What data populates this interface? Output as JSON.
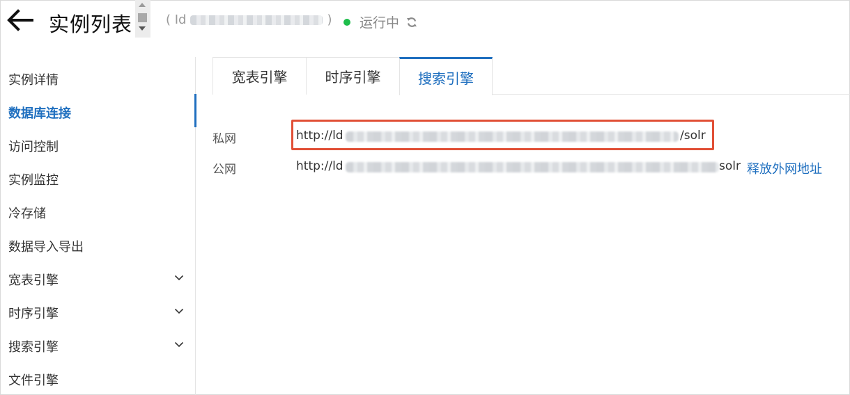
{
  "header": {
    "title": "实例列表",
    "id_open": "( Id",
    "id_close": ")",
    "status_text": "运行中",
    "status_color": "#1ebe4b"
  },
  "sidebar": {
    "items": [
      {
        "label": "实例详情"
      },
      {
        "label": "数据库连接",
        "active": true
      },
      {
        "label": "访问控制"
      },
      {
        "label": "实例监控"
      },
      {
        "label": "冷存储"
      },
      {
        "label": "数据导入导出"
      },
      {
        "label": "宽表引擎",
        "expandable": true
      },
      {
        "label": "时序引擎",
        "expandable": true
      },
      {
        "label": "搜索引擎",
        "expandable": true
      },
      {
        "label": "文件引擎"
      }
    ]
  },
  "tabs": [
    {
      "label": "宽表引擎"
    },
    {
      "label": "时序引擎"
    },
    {
      "label": "搜索引擎",
      "active": true
    }
  ],
  "connections": {
    "private": {
      "label": "私网",
      "prefix": "http://ld",
      "suffix": "/solr"
    },
    "public": {
      "label": "公网",
      "prefix": "http://ld",
      "suffix": "solr",
      "action": "释放外网地址"
    }
  },
  "colors": {
    "accent": "#1f6fbf",
    "highlight_border": "#e14f36"
  }
}
